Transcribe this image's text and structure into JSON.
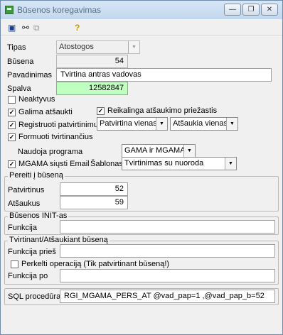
{
  "window": {
    "title": "Būsenos koregavimas"
  },
  "titlebar_buttons": {
    "minimize": "—",
    "restore": "❐",
    "close": "✕"
  },
  "toolbar": {
    "icons": [
      "save-icon",
      "tree-icon",
      "copy-icon",
      "help-icon"
    ],
    "glyphs": {
      "save": "▣",
      "tree": "⚯",
      "copy": "⧉",
      "help": "?"
    }
  },
  "form": {
    "tipas_label": "Tipas",
    "tipas_value": "Atostogos",
    "busena_label": "Būsena",
    "busena_value": "54",
    "pavadinimas_label": "Pavadinimas",
    "pavadinimas_value": "Tvirtina antras vadovas",
    "spalva_label": "Spalva",
    "spalva_value": "12582847",
    "spalva_color": "#bfffbf"
  },
  "checks": {
    "neaktyvus": {
      "label": "Neaktyvus",
      "checked": false
    },
    "galima_atsaukti": {
      "label": "Galima atšaukti",
      "checked": true
    },
    "reikalinga_priezastis": {
      "label": "Reikalinga atšaukimo priežastis",
      "checked": true
    },
    "registruoti": {
      "label": "Registruoti patvirtinimus",
      "checked": true
    },
    "formuoti": {
      "label": "Formuoti tvirtinančius",
      "checked": true
    },
    "mgama_email": {
      "label": "MGAMA siųsti Email",
      "checked": true
    },
    "perkelti": {
      "label": "Perkelti operaciją (Tik patvirtinant būseną!)",
      "checked": false
    }
  },
  "combos": {
    "patvirtina": "Patvirtina vienas",
    "atsaukia": "Atšaukia vienas",
    "programa_label": "Naudoja programa",
    "programa_value": "GAMA ir MGAMA",
    "sablonas_label": "Šablonas",
    "sablonas_value": "Tvirtinimas su nuoroda"
  },
  "pereiti": {
    "title": "Pereiti į būseną",
    "patvirtinus_label": "Patvirtinus",
    "patvirtinus_value": "52",
    "atsaukus_label": "Atšaukus",
    "atsaukus_value": "59"
  },
  "init": {
    "title": "Būsenos INIT-as",
    "funkcija_label": "Funkcija",
    "funkcija_value": ""
  },
  "tvirtinant": {
    "title": "Tvirtinant/Atšaukiant būseną",
    "pries_label": "Funkcija prieš",
    "pries_value": "",
    "po_label": "Funkcija po",
    "po_value": ""
  },
  "sql": {
    "label": "SQL procedūra",
    "value": "RGI_MGAMA_PERS_AT @vad_pap=1 ,@vad_pap_b=52"
  }
}
